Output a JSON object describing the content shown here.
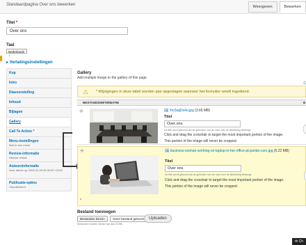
{
  "header": {
    "title": "Standaardpagina Over ons bewerken",
    "tabs": [
      {
        "label": "Weergeven"
      },
      {
        "label": "Bewerken"
      }
    ]
  },
  "form": {
    "title_label": "Titel",
    "title_required": "*",
    "title_value": "Over ons",
    "language_label": "Taal",
    "language_value": "Nederlands ↕",
    "translation_link": "▸ Vertalingsinstellingen"
  },
  "vertical_tabs": [
    {
      "title": "Kop",
      "sub": ""
    },
    {
      "title": "Intro",
      "sub": ""
    },
    {
      "title": "Diavoorstelling",
      "sub": ""
    },
    {
      "title": "Inhoud",
      "sub": ""
    },
    {
      "title": "Bijlagen",
      "sub": ""
    },
    {
      "title": "Gallery",
      "sub": ""
    },
    {
      "title": "Call To Action *",
      "sub": ""
    },
    {
      "title": "Menu-instellingen",
      "sub": "Niet in een menu"
    },
    {
      "title": "Revisie-informatie",
      "sub": "Nieuwe revisie"
    },
    {
      "title": "Auteursinformatie",
      "sub": "Door admin op 2015-02-28 00:35:30 +0100"
    },
    {
      "title": "Publicatie-opties",
      "sub": "Gepubliceerd"
    }
  ],
  "gallery": {
    "heading": "Gallery",
    "description": "Add multiple image to the gallery of this page",
    "warning": "* Wijzigingen in deze tabel worden pas opgeslagen wanneer het formulier wordt ingediend.",
    "column_header": "BESTANDSINFORMATIE",
    "items": [
      {
        "filename": "YicSsgDx4u.jpg",
        "size": "(3.65 MB)",
        "title_label": "Titel",
        "title_value": "Over ons",
        "hint": "De titel wordt getoond als de gebruiker met de muis over de afbeelding beweegt.",
        "instructions": [
          "Click and drag the crosshair to target the most important portion of the image.",
          "This portion of the image will never be cropped."
        ]
      },
      {
        "filename": "business-woman-working-on-laptop-in-her-office-picjumbo-com.jpg",
        "size": "(5.22 MB)",
        "title_label": "Titel",
        "title_value": "Over ons",
        "hint": "De titel wordt getoond als de gebruiker met de muis over de afbeelding beweegt.",
        "instructions": [
          "Click and drag the crosshair to target the most important portion of the image.",
          "This portion of the image will never be cropped."
        ]
      }
    ],
    "add_file_label": "Bestand toevoegen",
    "choose_button": "Bestanden kiezen",
    "no_file": "Geen bestand gekozen",
    "upload_button": "Uploaden",
    "limit_note": "Bestanden moeten kleiner zijn dan 32 MB."
  },
  "chat_label": "Ch",
  "colors": {
    "accent": "#0071b3",
    "warning_bg": "#fdf8d8",
    "highlight_bg": "#fffbd0",
    "required": "#cc0000"
  }
}
